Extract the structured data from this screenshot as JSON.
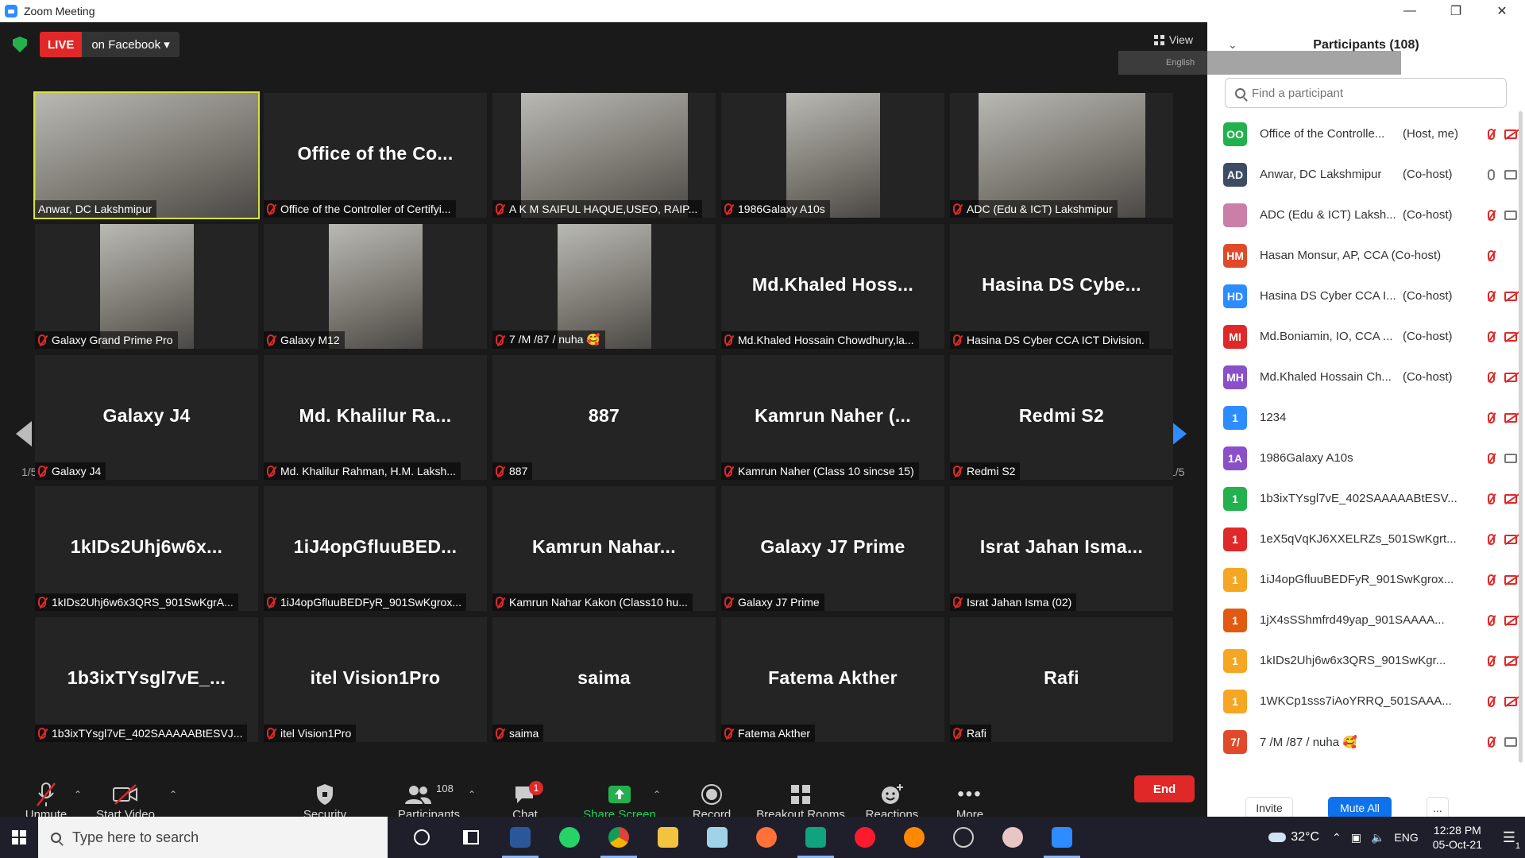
{
  "window": {
    "title": "Zoom Meeting"
  },
  "topbar": {
    "live_label": "LIVE",
    "live_target": "on Facebook",
    "view_label": "View",
    "language": "English"
  },
  "pagination": {
    "left": "1/5",
    "right": "1/5"
  },
  "tiles": [
    {
      "big": "",
      "caption": "Anwar, DC Lakshmipur",
      "video": true,
      "muted": false,
      "active": true,
      "vw": 281
    },
    {
      "big": "Office of the Co...",
      "caption": "Office of the Controller of Certifyi...",
      "video": false,
      "muted": true
    },
    {
      "big": "",
      "caption": "A K M SAIFUL HAQUE,USEO, RAIP...",
      "video": true,
      "muted": true,
      "vw": 210
    },
    {
      "big": "",
      "caption": "1986Galaxy A10s",
      "video": true,
      "muted": true,
      "vw": 118
    },
    {
      "big": "",
      "caption": "ADC (Edu & ICT) Lakshmipur",
      "video": true,
      "muted": true,
      "vw": 210
    },
    {
      "big": "",
      "caption": "Galaxy Grand Prime Pro",
      "video": true,
      "muted": true,
      "vw": 118
    },
    {
      "big": "",
      "caption": "Galaxy M12",
      "video": true,
      "muted": true,
      "vw": 118
    },
    {
      "big": "",
      "caption": "7 /M /87 / nuha 🥰",
      "video": true,
      "muted": true,
      "vw": 118
    },
    {
      "big": "Md.Khaled  Hoss...",
      "caption": "Md.Khaled Hossain Chowdhury,la...",
      "video": false,
      "muted": true
    },
    {
      "big": "Hasina DS Cybe...",
      "caption": "Hasina DS Cyber CCA ICT Division.",
      "video": false,
      "muted": true
    },
    {
      "big": "Galaxy J4",
      "caption": "Galaxy J4",
      "video": false,
      "muted": true
    },
    {
      "big": "Md.  Khalilur  Ra...",
      "caption": "Md. Khalilur Rahman, H.M. Laksh...",
      "video": false,
      "muted": true
    },
    {
      "big": "887",
      "caption": "887",
      "video": false,
      "muted": true
    },
    {
      "big": "Kamrun  Naher  (...",
      "caption": "Kamrun Naher (Class 10 sincse 15)",
      "video": false,
      "muted": true
    },
    {
      "big": "Redmi S2",
      "caption": "Redmi S2",
      "video": false,
      "muted": true
    },
    {
      "big": "1kIDs2Uhj6w6x...",
      "caption": "1kIDs2Uhj6w6x3QRS_901SwKgrA...",
      "video": false,
      "muted": true
    },
    {
      "big": "1iJ4opGfluuBED...",
      "caption": "1iJ4opGfluuBEDFyR_901SwKgrox...",
      "video": false,
      "muted": true
    },
    {
      "big": "Kamrun  Nahar...",
      "caption": "Kamrun Nahar Kakon (Class10 hu...",
      "video": false,
      "muted": true
    },
    {
      "big": "Galaxy J7 Prime",
      "caption": "Galaxy J7 Prime",
      "video": false,
      "muted": true
    },
    {
      "big": "Israt  Jahan  Isma...",
      "caption": "Israt Jahan Isma (02)",
      "video": false,
      "muted": true
    },
    {
      "big": "1b3ixTYsgl7vE_...",
      "caption": "1b3ixTYsgl7vE_402SAAAAABtESVJ...",
      "video": false,
      "muted": true
    },
    {
      "big": "itel Vision1Pro",
      "caption": "itel Vision1Pro",
      "video": false,
      "muted": true
    },
    {
      "big": "saima",
      "caption": "saima",
      "video": false,
      "muted": true
    },
    {
      "big": "Fatema Akther",
      "caption": "Fatema Akther",
      "video": false,
      "muted": true
    },
    {
      "big": "Rafi",
      "caption": "Rafi",
      "video": false,
      "muted": true
    }
  ],
  "toolbar": {
    "unmute": "Unmute",
    "start_video": "Start Video",
    "security": "Security",
    "participants": "Participants",
    "participants_count": "108",
    "chat": "Chat",
    "chat_badge": "1",
    "share_screen": "Share Screen",
    "record": "Record",
    "breakout": "Breakout Rooms",
    "reactions": "Reactions",
    "more": "More",
    "end": "End"
  },
  "panel": {
    "title": "Participants (108)",
    "search_placeholder": "Find a participant",
    "invite": "Invite",
    "mute_all": "Mute All",
    "more": "...",
    "participants": [
      {
        "initials": "OO",
        "color": "#23b14d",
        "name": "Office of the Controlle...",
        "role": "(Host, me)",
        "mic": "off",
        "cam": "off"
      },
      {
        "initials": "AD",
        "color": "#3d4c63",
        "name": "Anwar, DC Lakshmipur",
        "role": "(Co-host)",
        "mic": "on",
        "cam": "on"
      },
      {
        "initials": "",
        "color": "#c97fa8",
        "name": "ADC (Edu & ICT) Laksh...",
        "role": "(Co-host)",
        "mic": "off",
        "cam": "on"
      },
      {
        "initials": "HM",
        "color": "#e04a2a",
        "name": "Hasan Monsur, AP, CCA (Co-host)",
        "role": "",
        "mic": "off",
        "cam": "none"
      },
      {
        "initials": "HD",
        "color": "#2d8cff",
        "name": "Hasina DS Cyber CCA I...",
        "role": "(Co-host)",
        "mic": "off",
        "cam": "off"
      },
      {
        "initials": "MI",
        "color": "#e02828",
        "name": "Md.Boniamin, IO, CCA ...",
        "role": "(Co-host)",
        "mic": "off",
        "cam": "off"
      },
      {
        "initials": "MH",
        "color": "#8b4fc9",
        "name": "Md.Khaled Hossain Ch...",
        "role": "(Co-host)",
        "mic": "off",
        "cam": "off"
      },
      {
        "initials": "1",
        "color": "#2d8cff",
        "name": "1234",
        "role": "",
        "mic": "off",
        "cam": "off"
      },
      {
        "initials": "1A",
        "color": "#8b4fc9",
        "name": "1986Galaxy A10s",
        "role": "",
        "mic": "off",
        "cam": "on"
      },
      {
        "initials": "1",
        "color": "#23b14d",
        "name": "1b3ixTYsgl7vE_402SAAAAABtESV...",
        "role": "",
        "mic": "off",
        "cam": "off"
      },
      {
        "initials": "1",
        "color": "#e02828",
        "name": "1eX5qVqKJ6XXELRZs_501SwKgrt...",
        "role": "",
        "mic": "off",
        "cam": "off"
      },
      {
        "initials": "1",
        "color": "#f5a623",
        "name": "1iJ4opGfluuBEDFyR_901SwKgrox...",
        "role": "",
        "mic": "off",
        "cam": "off"
      },
      {
        "initials": "1",
        "color": "#e05a12",
        "name": "1jX4sSShmfrd49yap_901SAAAA...",
        "role": "",
        "mic": "off",
        "cam": "off"
      },
      {
        "initials": "1",
        "color": "#f5a623",
        "name": "1kIDs2Uhj6w6x3QRS_901SwKgr...",
        "role": "",
        "mic": "off",
        "cam": "off"
      },
      {
        "initials": "1",
        "color": "#f5a623",
        "name": "1WKCp1sss7iAoYRRQ_501SAAA...",
        "role": "",
        "mic": "off",
        "cam": "off"
      },
      {
        "initials": "7/",
        "color": "#e04a2a",
        "name": "7 /M /87 / nuha 🥰",
        "role": "",
        "mic": "off",
        "cam": "on"
      }
    ]
  },
  "taskbar": {
    "search_placeholder": "Type here to search",
    "temperature": "32°C",
    "lang": "ENG",
    "time": "12:28 PM",
    "date": "05-Oct-21",
    "notif_count": "1"
  }
}
